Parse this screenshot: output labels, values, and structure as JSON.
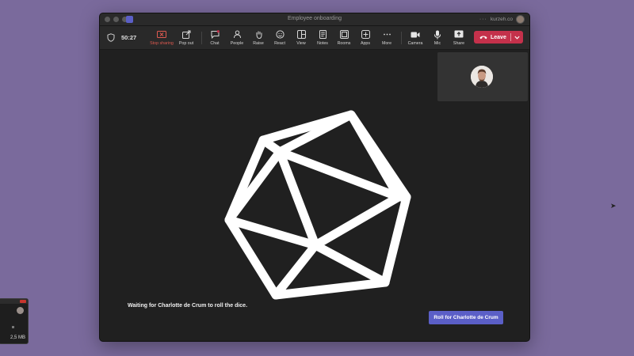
{
  "window": {
    "title": "Employee onboarding",
    "org_label": "kurzeh.co"
  },
  "toolbar": {
    "timer": "50:27",
    "items": [
      {
        "label": "Stop sharing",
        "icon": "stop-sharing-icon",
        "color": "#e05a50"
      },
      {
        "label": "Pop out",
        "icon": "pop-out-icon"
      },
      {
        "label": "Chat",
        "icon": "chat-icon"
      },
      {
        "label": "People",
        "icon": "people-icon"
      },
      {
        "label": "Raise",
        "icon": "raise-hand-icon"
      },
      {
        "label": "React",
        "icon": "react-icon"
      },
      {
        "label": "View",
        "icon": "view-icon"
      },
      {
        "label": "Notes",
        "icon": "notes-icon"
      },
      {
        "label": "Rooms",
        "icon": "rooms-icon"
      },
      {
        "label": "Apps",
        "icon": "apps-icon"
      },
      {
        "label": "More",
        "icon": "more-icon"
      },
      {
        "label": "Camera",
        "icon": "camera-icon"
      },
      {
        "label": "Mic",
        "icon": "mic-icon"
      },
      {
        "label": "Share",
        "icon": "share-icon"
      }
    ],
    "leave_label": "Leave",
    "leave_color": "#c4314b"
  },
  "stage": {
    "waiting_text": "Waiting for Charlotte de Crum to roll the dice.",
    "roll_button": "Roll for Charlotte de Crum",
    "roll_color": "#5b5fc7"
  },
  "desktop": {
    "background": "#7a6a9c",
    "thumbnail_size": "2,5 MB"
  }
}
